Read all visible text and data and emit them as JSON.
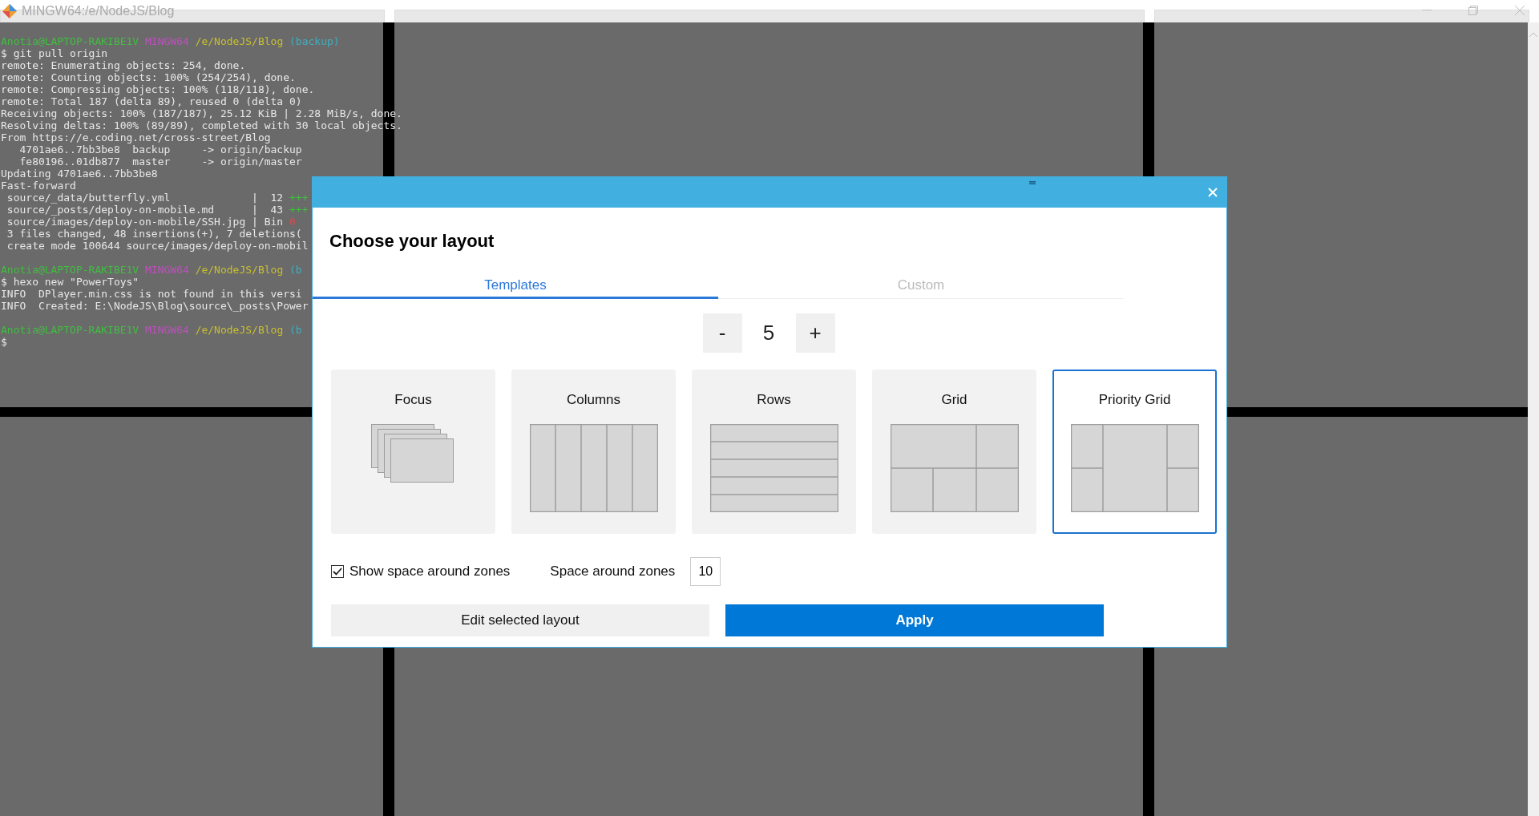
{
  "window": {
    "title": "MINGW64:/e/NodeJS/Blog"
  },
  "terminal": {
    "lines": [
      {
        "segments": [
          {
            "kind": "user",
            "text": "Anotia@LAPTOP-RAKIBE1V "
          },
          {
            "kind": "host",
            "text": "MINGW64 "
          },
          {
            "kind": "path",
            "text": "/e/NodeJS/Blog "
          },
          {
            "kind": "branch",
            "text": "(backup)"
          }
        ]
      },
      {
        "segments": [
          {
            "kind": "plain",
            "text": "$ git pull origin"
          }
        ]
      },
      {
        "segments": [
          {
            "kind": "plain",
            "text": "remote: Enumerating objects: 254, done."
          }
        ]
      },
      {
        "segments": [
          {
            "kind": "plain",
            "text": "remote: Counting objects: 100% (254/254), done."
          }
        ]
      },
      {
        "segments": [
          {
            "kind": "plain",
            "text": "remote: Compressing objects: 100% (118/118), done."
          }
        ]
      },
      {
        "segments": [
          {
            "kind": "plain",
            "text": "remote: Total 187 (delta 89), reused 0 (delta 0)"
          }
        ]
      },
      {
        "segments": [
          {
            "kind": "plain",
            "text": "Receiving objects: 100% (187/187), 25.12 KiB | 2.28 MiB/s, done."
          }
        ]
      },
      {
        "segments": [
          {
            "kind": "plain",
            "text": "Resolving deltas: 100% (89/89), completed with 30 local objects."
          }
        ]
      },
      {
        "segments": [
          {
            "kind": "plain",
            "text": "From https://e.coding.net/cross-street/Blog"
          }
        ]
      },
      {
        "segments": [
          {
            "kind": "plain",
            "text": "   4701ae6..7bb3be8  backup     -> origin/backup"
          }
        ]
      },
      {
        "segments": [
          {
            "kind": "plain",
            "text": "   fe80196..01db877  master     -> origin/master"
          }
        ]
      },
      {
        "segments": [
          {
            "kind": "plain",
            "text": "Updating 4701ae6..7bb3be8"
          }
        ]
      },
      {
        "segments": [
          {
            "kind": "plain",
            "text": "Fast-forward"
          }
        ]
      },
      {
        "segments": [
          {
            "kind": "plain",
            "text": " source/_data/butterfly.yml             |  12 "
          },
          {
            "kind": "added",
            "text": "+++"
          }
        ]
      },
      {
        "segments": [
          {
            "kind": "plain",
            "text": " source/_posts/deploy-on-mobile.md      |  43 "
          },
          {
            "kind": "added",
            "text": "+++"
          }
        ]
      },
      {
        "segments": [
          {
            "kind": "plain",
            "text": " source/images/deploy-on-mobile/SSH.jpg | Bin "
          },
          {
            "kind": "removed",
            "text": "0"
          }
        ]
      },
      {
        "segments": [
          {
            "kind": "plain",
            "text": " 3 files changed, 48 insertions(+), 7 deletions("
          }
        ]
      },
      {
        "segments": [
          {
            "kind": "plain",
            "text": " create mode 100644 source/images/deploy-on-mobil"
          }
        ]
      },
      {
        "space_before": true,
        "segments": [
          {
            "kind": "user",
            "text": "Anotia@LAPTOP-RAKIBE1V "
          },
          {
            "kind": "host",
            "text": "MINGW64 "
          },
          {
            "kind": "path",
            "text": "/e/NodeJS/Blog "
          },
          {
            "kind": "branch",
            "text": "(b"
          }
        ]
      },
      {
        "segments": [
          {
            "kind": "plain",
            "text": "$ hexo new \"PowerToys\""
          }
        ]
      },
      {
        "segments": [
          {
            "kind": "plain",
            "text": "INFO  DPlayer.min.css is not found in this versi"
          }
        ]
      },
      {
        "segments": [
          {
            "kind": "plain",
            "text": "INFO  Created: E:\\NodeJS\\Blog\\source\\_posts\\Power"
          }
        ]
      },
      {
        "space_before": true,
        "segments": [
          {
            "kind": "user",
            "text": "Anotia@LAPTOP-RAKIBE1V "
          },
          {
            "kind": "host",
            "text": "MINGW64 "
          },
          {
            "kind": "path",
            "text": "/e/NodeJS/Blog "
          },
          {
            "kind": "branch",
            "text": "(b"
          }
        ]
      },
      {
        "segments": [
          {
            "kind": "plain",
            "text": "$"
          }
        ]
      }
    ]
  },
  "dialog": {
    "title": "Choose your layout",
    "tabs": [
      {
        "label": "Templates",
        "selected": true
      },
      {
        "label": "Custom",
        "selected": false
      }
    ],
    "stepper": {
      "decrement": "-",
      "value": "5",
      "increment": "+"
    },
    "layouts": [
      {
        "kind": "focus",
        "label": "Focus",
        "selected": false
      },
      {
        "kind": "columns",
        "label": "Columns",
        "selected": false
      },
      {
        "kind": "rows",
        "label": "Rows",
        "selected": false
      },
      {
        "kind": "grid",
        "label": "Grid",
        "selected": false
      },
      {
        "kind": "priority-grid",
        "label": "Priority Grid",
        "selected": true
      }
    ],
    "show_space": {
      "label": "Show space around zones",
      "checked": true
    },
    "space_around": {
      "label": "Space around zones",
      "value": "10"
    },
    "buttons": [
      {
        "kind": "secondary",
        "label": "Edit selected layout"
      },
      {
        "kind": "primary",
        "label": "Apply"
      }
    ]
  }
}
